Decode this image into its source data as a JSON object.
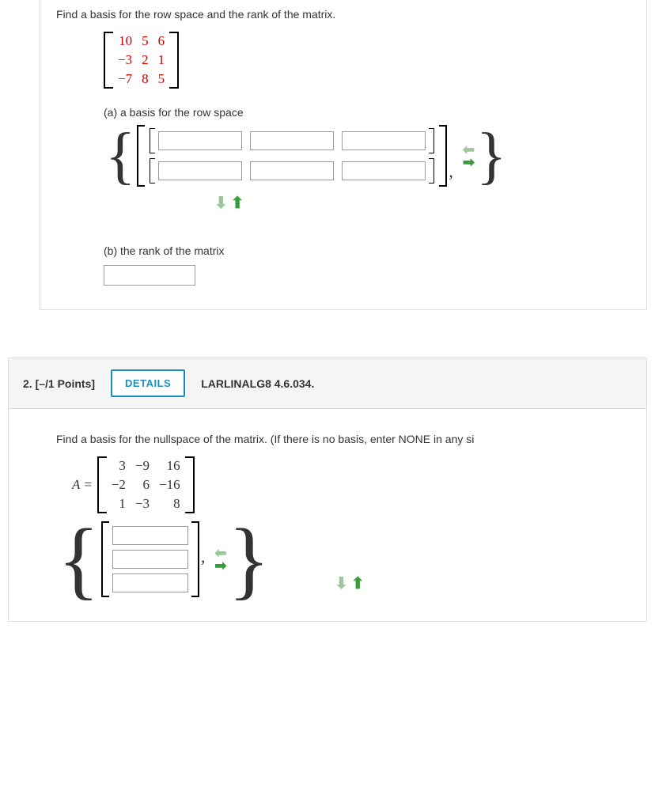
{
  "p1": {
    "stem": "Find a basis for the row space and the rank of the matrix.",
    "matrix": {
      "r1c1": "10",
      "r1c2": "5",
      "r1c3": "6",
      "r2c1": "−3",
      "r2c2": "2",
      "r2c3": "1",
      "r3c1": "−7",
      "r3c2": "8",
      "r3c3": "5"
    },
    "partA": "(a) a basis for the row space",
    "partB": "(b) the rank of the matrix"
  },
  "q2": {
    "number": "2.",
    "points": "[–/1 Points]",
    "details": "DETAILS",
    "ref": "LARLINALG8 4.6.034."
  },
  "p2": {
    "stem": "Find a basis for the nullspace of the matrix. (If there is no basis, enter NONE in any si",
    "Aeq": "A =",
    "matrix": {
      "r1c1": "3",
      "r1c2": "−9",
      "r1c3": "16",
      "r2c1": "−2",
      "r2c2": "6",
      "r2c3": "−16",
      "r3c1": "1",
      "r3c2": "−3",
      "r3c3": "8"
    }
  },
  "glyph": {
    "down": "⬇",
    "up": "⬆",
    "left": "⬅",
    "right": "➡"
  }
}
